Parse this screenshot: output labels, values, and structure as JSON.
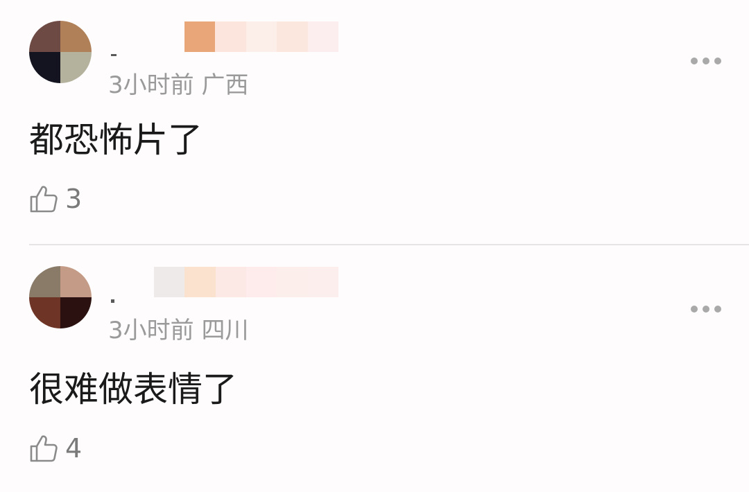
{
  "comments": [
    {
      "time": "3小时前",
      "location": "广西",
      "text": "都恐怖片了",
      "likes": "3",
      "avatar_colors": [
        "#6e4a45",
        "#b08059",
        "#141420",
        "#b4b19c"
      ],
      "name_blur_colors": [
        "#e9a779",
        "#fbe5dc",
        "#fcefea",
        "#fbe7de",
        "#fceeee"
      ],
      "more_icon": "more-dots-icon",
      "like_icon": "thumbs-up-icon"
    },
    {
      "time": "3小时前",
      "location": "四川",
      "text": "很难做表情了",
      "likes": "4",
      "avatar_colors": [
        "#8a7a68",
        "#c49b86",
        "#6e3527",
        "#2b1210"
      ],
      "name_blur_colors": [
        "#eeeaea",
        "#fbe2cf",
        "#fce9e6",
        "#fdeceb",
        "#fcefeb",
        "#fceeec"
      ],
      "more_icon": "more-dots-icon",
      "like_icon": "thumbs-up-icon"
    }
  ]
}
